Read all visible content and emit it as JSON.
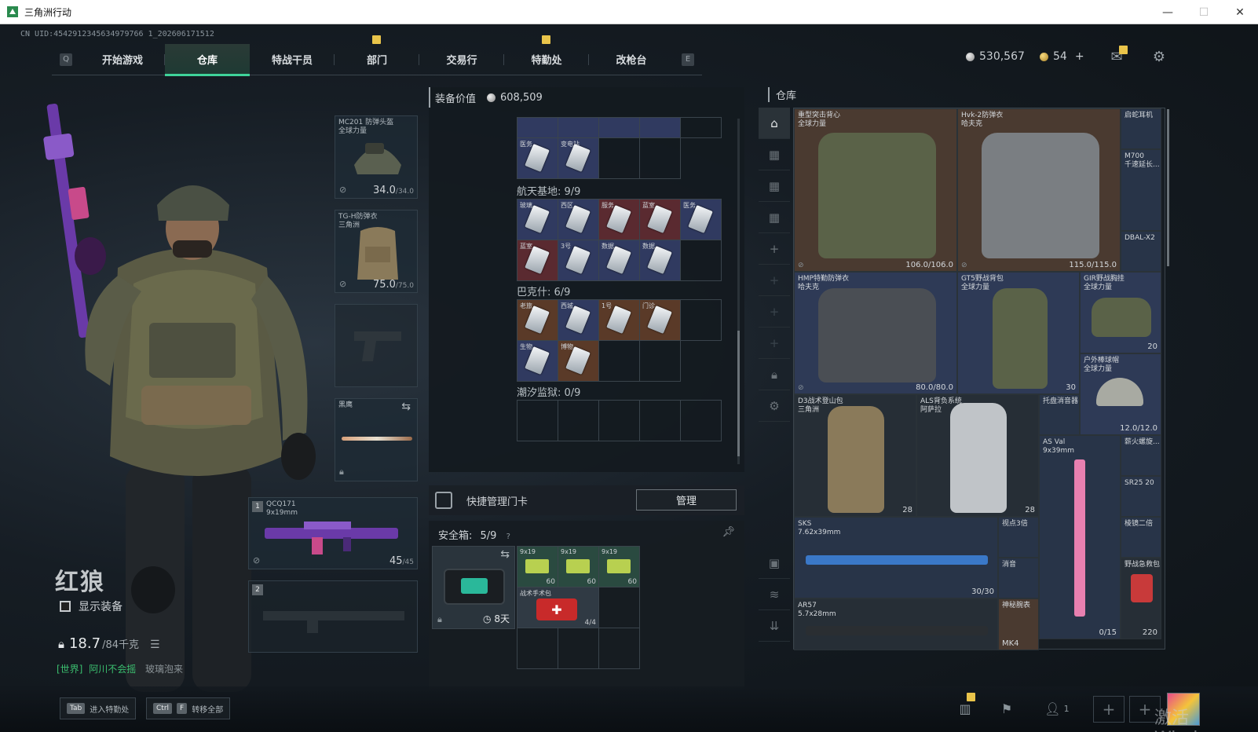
{
  "window": {
    "title": "三角洲行动",
    "minimize": "—",
    "maximize": "☐",
    "close": "✕"
  },
  "uid": "CN UID:4542912345634979766 1_202606171512",
  "nav": {
    "left_key": "Q",
    "right_key": "E",
    "tabs": [
      {
        "label": "开始游戏",
        "active": false,
        "badge": false
      },
      {
        "label": "仓库",
        "active": true,
        "badge": false
      },
      {
        "label": "特战干员",
        "active": false,
        "badge": false
      },
      {
        "label": "部门",
        "active": false,
        "badge": true
      },
      {
        "label": "交易行",
        "active": false,
        "badge": false
      },
      {
        "label": "特勤处",
        "active": false,
        "badge": true
      },
      {
        "label": "改枪台",
        "active": false,
        "badge": false
      }
    ]
  },
  "currency": {
    "silver": "530,567",
    "gold": "54",
    "gold_add": "+"
  },
  "character": {
    "name": "红狼",
    "show_equip_label": "显示装备",
    "weight_current": "18.7",
    "weight_max": "/84千克",
    "chat_tag": "[世界]",
    "chat_name": "阿川不会摇",
    "chat_msg": "玻璃泡来"
  },
  "equip_slots": {
    "helmet": {
      "name": "MC201 防弹头盔",
      "sub": "全球力量",
      "durability": "34.0",
      "durability_max": "/34.0"
    },
    "armor": {
      "name": "TG-H防弹衣",
      "sub": "三角洲",
      "durability": "75.0",
      "durability_max": "/75.0"
    },
    "melee": {
      "name": "黑鹰"
    },
    "primary1": {
      "index": "1",
      "name": "QCQ171",
      "caliber": "9x19mm",
      "ammo": "45",
      "ammo_max": "/45"
    },
    "primary2": {
      "index": "2"
    }
  },
  "middle": {
    "equip_value_label": "装备价值",
    "equip_value": "608,509",
    "sections": [
      {
        "title": "航天基地: 9/9"
      },
      {
        "title": "巴克什: 6/9"
      },
      {
        "title": "潮汐监狱: 0/9"
      }
    ],
    "top_cells": [
      "医务",
      "变电站",
      "",
      ""
    ],
    "space_cells": [
      "玻璃",
      "西区",
      "服务",
      "蓝室",
      "医务",
      "蓝室",
      "3号",
      "数据",
      "数据"
    ],
    "bakesh_cells": [
      "老旅",
      "西城",
      "1号",
      "门诊",
      "生物",
      "博物"
    ],
    "quick_manage_label": "快捷管理门卡",
    "manage_button": "管理",
    "safebox_label": "安全箱:",
    "safebox_count": "5/9",
    "safebox_timer": "8天",
    "safebox_items": [
      {
        "name": "9x19",
        "qty": "60"
      },
      {
        "name": "9x19",
        "qty": "60"
      },
      {
        "name": "9x19",
        "qty": "60"
      },
      {
        "name": "战术手术包",
        "qty": "4/4"
      }
    ]
  },
  "warehouse": {
    "title": "仓库",
    "items": [
      {
        "name": "重型突击背心",
        "sub": "全球力量",
        "value": "106.0/106.0"
      },
      {
        "name": "Hvk-2防弹衣",
        "sub": "哈夫克",
        "value": "115.0/115.0"
      },
      {
        "name": "启蛇耳机",
        "sub": "",
        "value": ""
      },
      {
        "name": "M700",
        "sub": "千速延长...",
        "value": ""
      },
      {
        "name": "DBAL-X2",
        "sub": "",
        "value": ""
      },
      {
        "name": "HMP特勤防弹衣",
        "sub": "哈夫克",
        "value": "80.0/80.0"
      },
      {
        "name": "GT5野战背包",
        "sub": "全球力量",
        "value": "30"
      },
      {
        "name": "GIR野战胸挂",
        "sub": "全球力量",
        "value": "20"
      },
      {
        "name": "户外棒球帽",
        "sub": "全球力量",
        "value": "12.0/12.0"
      },
      {
        "name": "D3战术登山包",
        "sub": "三角洲",
        "value": "28"
      },
      {
        "name": "ALS背负系统",
        "sub": "阿萨拉",
        "value": "28"
      },
      {
        "name": "托盘消音器",
        "sub": "",
        "value": ""
      },
      {
        "name": "AS Val",
        "sub": "9x39mm",
        "value": "0/15"
      },
      {
        "name": "薪火螺旋...",
        "sub": "",
        "value": ""
      },
      {
        "name": "SR25 20",
        "sub": "",
        "value": ""
      },
      {
        "name": "SKS",
        "sub": "7.62x39mm",
        "value": "30/30"
      },
      {
        "name": "视点3倍",
        "sub": "",
        "value": ""
      },
      {
        "name": "棱镜二倍",
        "sub": "",
        "value": ""
      },
      {
        "name": "消音",
        "sub": "",
        "value": ""
      },
      {
        "name": "野战急救包",
        "sub": "",
        "value": "220"
      },
      {
        "name": "AR57",
        "sub": "5.7x28mm",
        "value": ""
      },
      {
        "name": "神秘腕表",
        "sub": "",
        "value": ""
      },
      {
        "name": "MK4",
        "sub": "",
        "value": ""
      }
    ]
  },
  "bottom": {
    "hint1_key": "Tab",
    "hint1_label": "进入特勤处",
    "hint2_key1": "Ctrl",
    "hint2_key2": "F",
    "hint2_label": "转移全部",
    "party_count": "1",
    "watermark": "激活 Windows"
  },
  "colors": {
    "accent": "#3fd39a",
    "badge": "#e9c44a",
    "chat": "#3bbf6f"
  }
}
